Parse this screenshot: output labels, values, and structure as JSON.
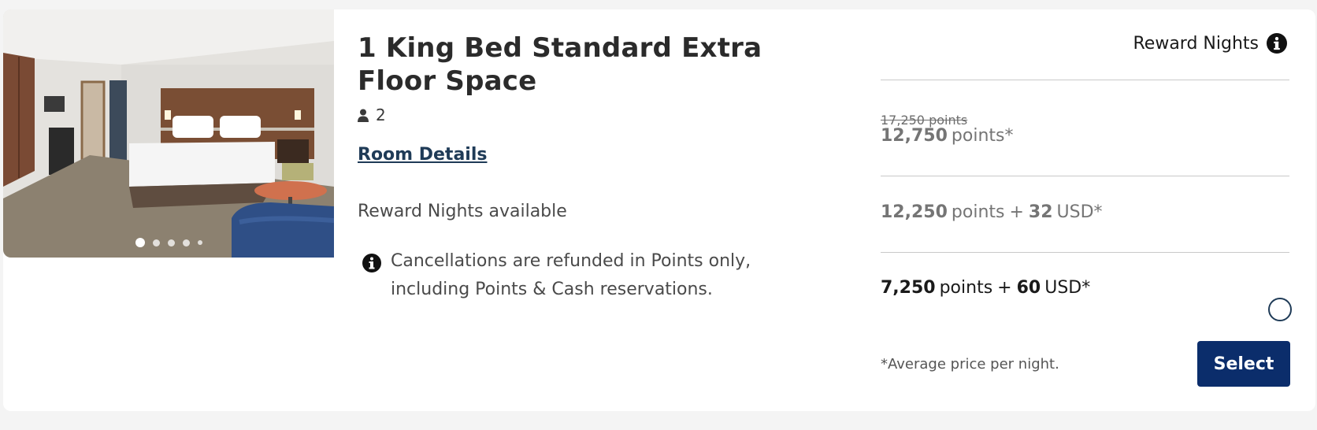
{
  "room": {
    "title": "1 King Bed Standard Extra Floor Space",
    "guests": "2",
    "room_details_link": "Room Details",
    "reward_availability": "Reward Nights available",
    "cancellation_note": "Cancellations are refunded in Points only, including Points & Cash reservations.",
    "photo_count": 5,
    "active_photo_index": 0
  },
  "rates": {
    "header_label": "Reward Nights",
    "options": [
      {
        "original": "17,250 points",
        "amount": "12,750",
        "unit": "points*",
        "selected": false
      },
      {
        "amount": "12,250",
        "unit": "points",
        "plus": "+",
        "cash": "32",
        "currency": "USD*",
        "selected": false
      },
      {
        "amount": "7,250",
        "unit": "points",
        "plus": "+",
        "cash": "60",
        "currency": "USD*",
        "selected": true
      }
    ],
    "footnote": "*Average price per night.",
    "select_label": "Select"
  },
  "colors": {
    "select_button": "#0b2d6b",
    "link": "#1f3b57",
    "muted_price": "#757575"
  },
  "icons": {
    "guest": "person-icon",
    "info": "info-circle-icon",
    "rate_radio": "radio-button"
  }
}
